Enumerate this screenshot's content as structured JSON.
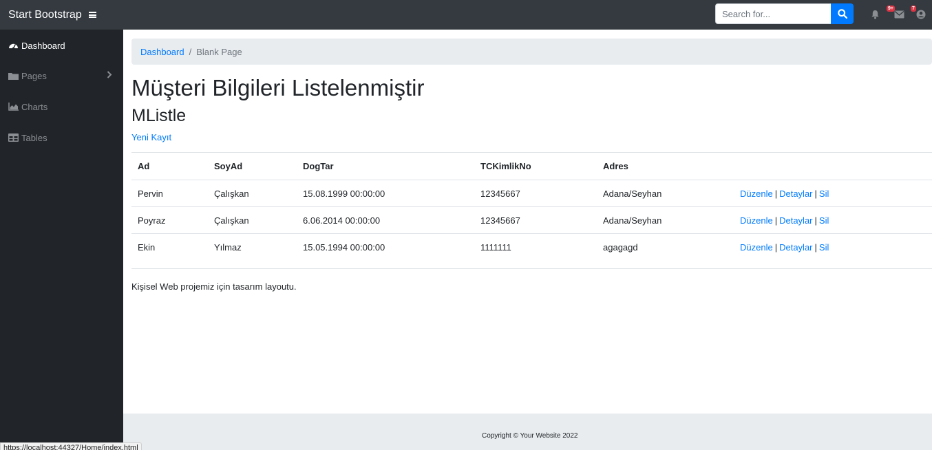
{
  "navbar": {
    "brand": "Start Bootstrap",
    "search_placeholder": "Search for...",
    "alerts_badge": "9+",
    "messages_badge": "7"
  },
  "sidebar": {
    "items": [
      {
        "label": "Dashboard",
        "icon": "tachometer-icon"
      },
      {
        "label": "Pages",
        "icon": "folder-icon"
      },
      {
        "label": "Charts",
        "icon": "area-chart-icon"
      },
      {
        "label": "Tables",
        "icon": "table-icon"
      }
    ]
  },
  "breadcrumb": {
    "home": "Dashboard",
    "separator": "/",
    "current": "Blank Page"
  },
  "main": {
    "title": "Müşteri Bilgileri Listelenmiştir",
    "subtitle": "MListle",
    "new_record_link": "Yeni Kayıt",
    "table": {
      "headers": [
        "Ad",
        "SoyAd",
        "DogTar",
        "TCKimlikNo",
        "Adres",
        ""
      ],
      "rows": [
        [
          "Pervin",
          "Çalışkan",
          "15.08.1999 00:00:00",
          "12345667",
          "Adana/Seyhan"
        ],
        [
          "Poyraz",
          "Çalışkan",
          "6.06.2014 00:00:00",
          "12345667",
          "Adana/Seyhan"
        ],
        [
          "Ekin",
          "Yılmaz",
          "15.05.1994 00:00:00",
          "1111111",
          "agagagd"
        ]
      ],
      "actions": {
        "edit": "Düzenle",
        "details": "Detaylar",
        "delete": "Sil",
        "separator": "|"
      }
    },
    "footnote": "Kişisel Web projemiz için tasarım layoutu."
  },
  "footer": {
    "copyright": "Copyright © Your Website 2022"
  },
  "statusbar": {
    "url": "https://localhost:44327/Home/index.html"
  },
  "colors": {
    "navbar": "#343a40",
    "sidebar": "#212529",
    "link": "#007bff",
    "breadcrumb_bg": "#e9ecef",
    "badge": "#dc3545"
  }
}
